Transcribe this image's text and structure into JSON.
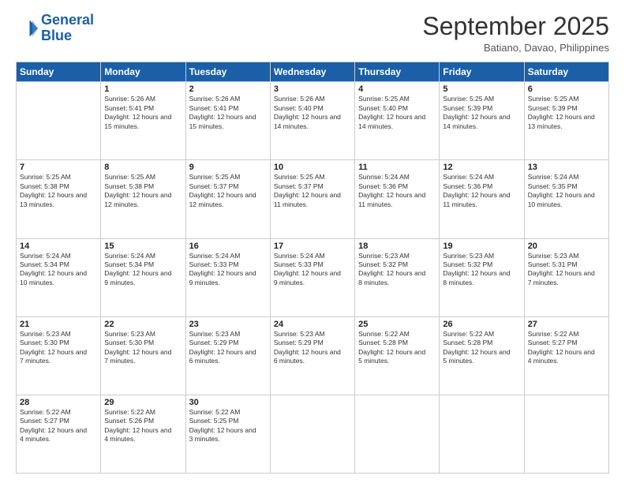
{
  "header": {
    "logo_line1": "General",
    "logo_line2": "Blue",
    "month": "September 2025",
    "location": "Batiano, Davao, Philippines"
  },
  "weekdays": [
    "Sunday",
    "Monday",
    "Tuesday",
    "Wednesday",
    "Thursday",
    "Friday",
    "Saturday"
  ],
  "weeks": [
    [
      {
        "day": "",
        "sunrise": "",
        "sunset": "",
        "daylight": ""
      },
      {
        "day": "1",
        "sunrise": "Sunrise: 5:26 AM",
        "sunset": "Sunset: 5:41 PM",
        "daylight": "Daylight: 12 hours and 15 minutes."
      },
      {
        "day": "2",
        "sunrise": "Sunrise: 5:26 AM",
        "sunset": "Sunset: 5:41 PM",
        "daylight": "Daylight: 12 hours and 15 minutes."
      },
      {
        "day": "3",
        "sunrise": "Sunrise: 5:26 AM",
        "sunset": "Sunset: 5:40 PM",
        "daylight": "Daylight: 12 hours and 14 minutes."
      },
      {
        "day": "4",
        "sunrise": "Sunrise: 5:25 AM",
        "sunset": "Sunset: 5:40 PM",
        "daylight": "Daylight: 12 hours and 14 minutes."
      },
      {
        "day": "5",
        "sunrise": "Sunrise: 5:25 AM",
        "sunset": "Sunset: 5:39 PM",
        "daylight": "Daylight: 12 hours and 14 minutes."
      },
      {
        "day": "6",
        "sunrise": "Sunrise: 5:25 AM",
        "sunset": "Sunset: 5:39 PM",
        "daylight": "Daylight: 12 hours and 13 minutes."
      }
    ],
    [
      {
        "day": "7",
        "sunrise": "Sunrise: 5:25 AM",
        "sunset": "Sunset: 5:38 PM",
        "daylight": "Daylight: 12 hours and 13 minutes."
      },
      {
        "day": "8",
        "sunrise": "Sunrise: 5:25 AM",
        "sunset": "Sunset: 5:38 PM",
        "daylight": "Daylight: 12 hours and 12 minutes."
      },
      {
        "day": "9",
        "sunrise": "Sunrise: 5:25 AM",
        "sunset": "Sunset: 5:37 PM",
        "daylight": "Daylight: 12 hours and 12 minutes."
      },
      {
        "day": "10",
        "sunrise": "Sunrise: 5:25 AM",
        "sunset": "Sunset: 5:37 PM",
        "daylight": "Daylight: 12 hours and 11 minutes."
      },
      {
        "day": "11",
        "sunrise": "Sunrise: 5:24 AM",
        "sunset": "Sunset: 5:36 PM",
        "daylight": "Daylight: 12 hours and 11 minutes."
      },
      {
        "day": "12",
        "sunrise": "Sunrise: 5:24 AM",
        "sunset": "Sunset: 5:36 PM",
        "daylight": "Daylight: 12 hours and 11 minutes."
      },
      {
        "day": "13",
        "sunrise": "Sunrise: 5:24 AM",
        "sunset": "Sunset: 5:35 PM",
        "daylight": "Daylight: 12 hours and 10 minutes."
      }
    ],
    [
      {
        "day": "14",
        "sunrise": "Sunrise: 5:24 AM",
        "sunset": "Sunset: 5:34 PM",
        "daylight": "Daylight: 12 hours and 10 minutes."
      },
      {
        "day": "15",
        "sunrise": "Sunrise: 5:24 AM",
        "sunset": "Sunset: 5:34 PM",
        "daylight": "Daylight: 12 hours and 9 minutes."
      },
      {
        "day": "16",
        "sunrise": "Sunrise: 5:24 AM",
        "sunset": "Sunset: 5:33 PM",
        "daylight": "Daylight: 12 hours and 9 minutes."
      },
      {
        "day": "17",
        "sunrise": "Sunrise: 5:24 AM",
        "sunset": "Sunset: 5:33 PM",
        "daylight": "Daylight: 12 hours and 9 minutes."
      },
      {
        "day": "18",
        "sunrise": "Sunrise: 5:23 AM",
        "sunset": "Sunset: 5:32 PM",
        "daylight": "Daylight: 12 hours and 8 minutes."
      },
      {
        "day": "19",
        "sunrise": "Sunrise: 5:23 AM",
        "sunset": "Sunset: 5:32 PM",
        "daylight": "Daylight: 12 hours and 8 minutes."
      },
      {
        "day": "20",
        "sunrise": "Sunrise: 5:23 AM",
        "sunset": "Sunset: 5:31 PM",
        "daylight": "Daylight: 12 hours and 7 minutes."
      }
    ],
    [
      {
        "day": "21",
        "sunrise": "Sunrise: 5:23 AM",
        "sunset": "Sunset: 5:30 PM",
        "daylight": "Daylight: 12 hours and 7 minutes."
      },
      {
        "day": "22",
        "sunrise": "Sunrise: 5:23 AM",
        "sunset": "Sunset: 5:30 PM",
        "daylight": "Daylight: 12 hours and 7 minutes."
      },
      {
        "day": "23",
        "sunrise": "Sunrise: 5:23 AM",
        "sunset": "Sunset: 5:29 PM",
        "daylight": "Daylight: 12 hours and 6 minutes."
      },
      {
        "day": "24",
        "sunrise": "Sunrise: 5:23 AM",
        "sunset": "Sunset: 5:29 PM",
        "daylight": "Daylight: 12 hours and 6 minutes."
      },
      {
        "day": "25",
        "sunrise": "Sunrise: 5:22 AM",
        "sunset": "Sunset: 5:28 PM",
        "daylight": "Daylight: 12 hours and 5 minutes."
      },
      {
        "day": "26",
        "sunrise": "Sunrise: 5:22 AM",
        "sunset": "Sunset: 5:28 PM",
        "daylight": "Daylight: 12 hours and 5 minutes."
      },
      {
        "day": "27",
        "sunrise": "Sunrise: 5:22 AM",
        "sunset": "Sunset: 5:27 PM",
        "daylight": "Daylight: 12 hours and 4 minutes."
      }
    ],
    [
      {
        "day": "28",
        "sunrise": "Sunrise: 5:22 AM",
        "sunset": "Sunset: 5:27 PM",
        "daylight": "Daylight: 12 hours and 4 minutes."
      },
      {
        "day": "29",
        "sunrise": "Sunrise: 5:22 AM",
        "sunset": "Sunset: 5:26 PM",
        "daylight": "Daylight: 12 hours and 4 minutes."
      },
      {
        "day": "30",
        "sunrise": "Sunrise: 5:22 AM",
        "sunset": "Sunset: 5:25 PM",
        "daylight": "Daylight: 12 hours and 3 minutes."
      },
      {
        "day": "",
        "sunrise": "",
        "sunset": "",
        "daylight": ""
      },
      {
        "day": "",
        "sunrise": "",
        "sunset": "",
        "daylight": ""
      },
      {
        "day": "",
        "sunrise": "",
        "sunset": "",
        "daylight": ""
      },
      {
        "day": "",
        "sunrise": "",
        "sunset": "",
        "daylight": ""
      }
    ]
  ]
}
